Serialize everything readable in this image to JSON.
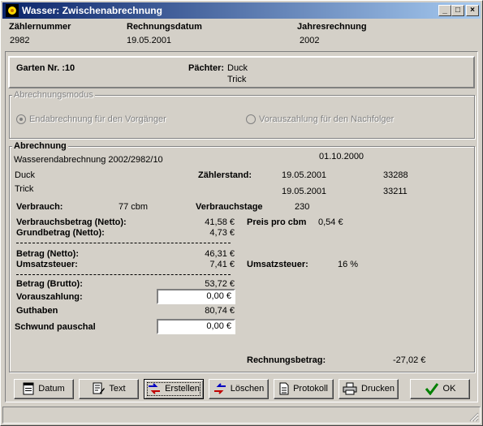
{
  "window": {
    "title": "Wasser: Zwischenabrechnung"
  },
  "header": {
    "zaehlernummer_label": "Zählernummer",
    "zaehlernummer": "2982",
    "rechnungsdatum_label": "Rechnungsdatum",
    "rechnungsdatum": "19.05.2001",
    "jahresrechnung_label": "Jahresrechnung",
    "jahresrechnung": "2002"
  },
  "garten": {
    "label": "Garten Nr. :10",
    "paechter_label": "Pächter:",
    "paechter1": "Duck",
    "paechter2": "Trick"
  },
  "modus": {
    "label": "Abrechnungsmodus",
    "opt1": "Endabrechnung für den Vorgänger",
    "opt2": "Vorauszahlung für den Nachfolger"
  },
  "abrechnung": {
    "label": "Abrechnung",
    "title": "Wasserendabrechnung 2002/2982/10",
    "date": "01.10.2000",
    "name1": "Duck",
    "name2": "Trick",
    "zaehlerstand_label": "Zählerstand:",
    "zs_date1": "19.05.2001",
    "zs_val1": "33288",
    "zs_date2": "19.05.2001",
    "zs_val2": "33211",
    "verbrauch_label": "Verbrauch:",
    "verbrauch": "77 cbm",
    "verbrauchstage_label": "Verbrauchstage",
    "verbrauchstage": "230",
    "vbetrag_label": "Verbrauchsbetrag (Netto):",
    "vbetrag": "41,58 €",
    "preis_label": "Preis pro  cbm",
    "preis": "0,54 €",
    "grundbetrag_label": "Grundbetrag (Netto):",
    "grundbetrag": "4,73 €",
    "betrag_netto_label": "Betrag (Netto):",
    "betrag_netto": "46,31 €",
    "ust_label": "Umsatzsteuer:",
    "ust": "7,41 €",
    "ust2_label": "Umsatzsteuer:",
    "ust_satz": "16 %",
    "brutto_label": "Betrag (Brutto):",
    "brutto": "53,72 €",
    "voraus_label": "Vorauszahlung:",
    "voraus": "0,00 €",
    "guthaben_label": "Guthaben",
    "guthaben": "80,74 €",
    "schwund_label": "Schwund pauschal",
    "schwund": "0,00 €",
    "rechnungsbetrag_label": "Rechnungsbetrag:",
    "rechnungsbetrag": "-27,02 €"
  },
  "buttons": {
    "datum": "Datum",
    "text": "Text",
    "erstellen": "Erstellen",
    "loeschen": "Löschen",
    "protokoll": "Protokoll",
    "drucken": "Drucken",
    "ok": "OK"
  }
}
